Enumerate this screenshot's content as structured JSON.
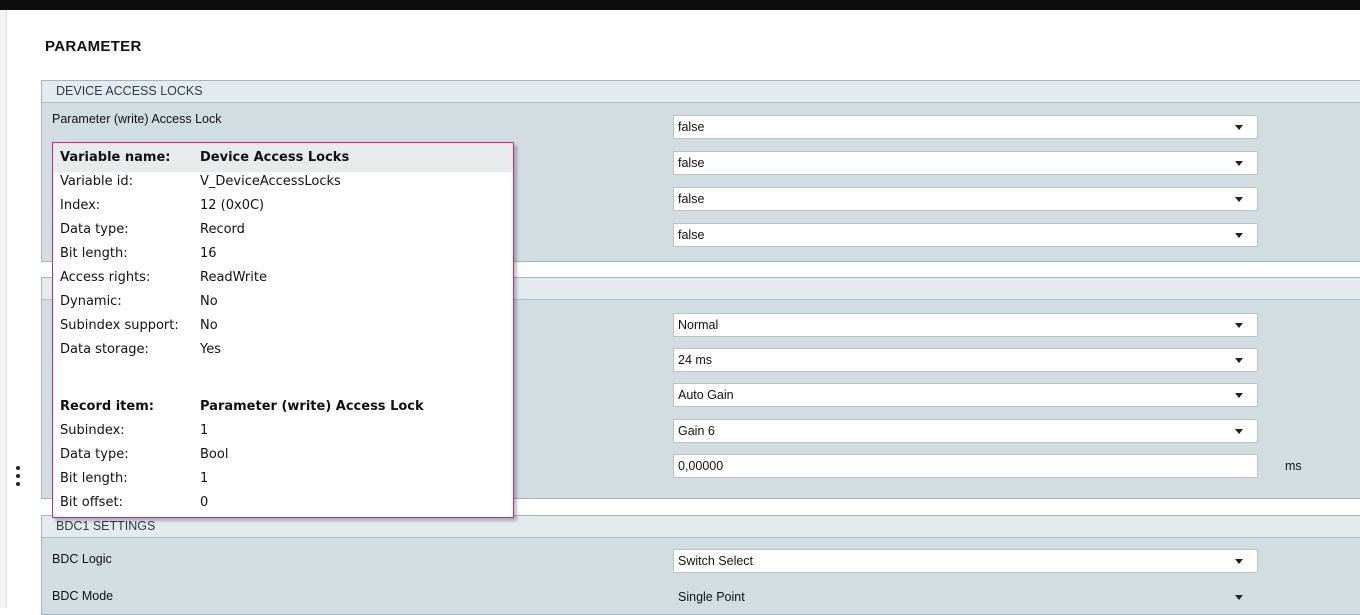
{
  "page_title": "PARAMETER",
  "groups": {
    "device_access_locks": {
      "header": "DEVICE ACCESS LOCKS",
      "rows": [
        {
          "label": "Parameter (write) Access Lock",
          "value": "false"
        },
        {
          "label": "",
          "value": "false"
        },
        {
          "label": "",
          "value": "false"
        },
        {
          "label": "",
          "value": "false"
        }
      ]
    },
    "second": {
      "header": "",
      "rows": [
        {
          "label": "",
          "value": "Normal"
        },
        {
          "label": "",
          "value": "24 ms"
        },
        {
          "label": "",
          "value": "Auto Gain"
        },
        {
          "label": "",
          "value": "Gain 6"
        },
        {
          "label": "",
          "value": "0,00000",
          "unit": "ms"
        }
      ]
    },
    "bdc1": {
      "header": "BDC1 SETTINGS",
      "rows": [
        {
          "label": "BDC Logic",
          "value": "Switch Select"
        },
        {
          "label": "BDC Mode",
          "value": "Single Point"
        }
      ]
    }
  },
  "tooltip": {
    "variable": [
      {
        "key": "Variable name:",
        "value": "Device Access Locks"
      },
      {
        "key": "Variable id:",
        "value": "V_DeviceAccessLocks"
      },
      {
        "key": "Index:",
        "value": "12 (0x0C)"
      },
      {
        "key": "Data type:",
        "value": "Record"
      },
      {
        "key": "Bit length:",
        "value": "16"
      },
      {
        "key": "Access rights:",
        "value": "ReadWrite"
      },
      {
        "key": "Dynamic:",
        "value": "No"
      },
      {
        "key": "Subindex support:",
        "value": "No"
      },
      {
        "key": "Data storage:",
        "value": "Yes"
      }
    ],
    "record": [
      {
        "key": "Record item:",
        "value": "Parameter (write) Access Lock"
      },
      {
        "key": "Subindex:",
        "value": "1"
      },
      {
        "key": "Data type:",
        "value": "Bool"
      },
      {
        "key": "Bit length:",
        "value": "1"
      },
      {
        "key": "Bit offset:",
        "value": "0"
      }
    ]
  },
  "colors": {
    "group_bg": "#d2dde1",
    "tooltip_border": "#c9287e"
  }
}
